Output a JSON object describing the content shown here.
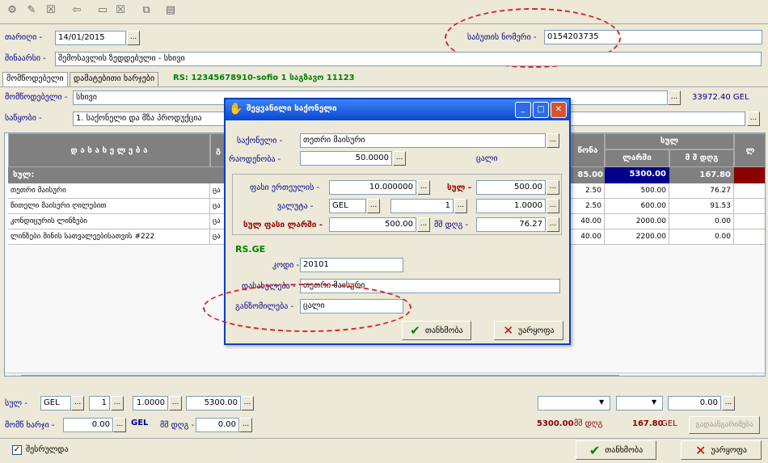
{
  "toolbar": {
    "icons": [
      "add-icon",
      "edit-icon",
      "delete-icon",
      "back-icon",
      "new-doc-icon",
      "cancel-doc-icon",
      "copy-icon",
      "print-icon"
    ]
  },
  "header": {
    "date_label": "თარიღი -",
    "date_value": "14/01/2015",
    "doc_number_label": "საბუთის ნომერი -",
    "doc_number_value": "0154203735",
    "note_label": "შინაარსი -",
    "note_value": "შემოსავლის ზედდებული - სხივი"
  },
  "tabs": {
    "supplier": "მომწოდებელი",
    "extra": "დამატებითი ხარჯები",
    "rs_info": "RS: 12345678910-sofio  1 საგზავო 11123"
  },
  "supplier": {
    "label": "მომწოდებელი -",
    "value": "სხივი",
    "amount": "33972.40 GEL"
  },
  "warehouse": {
    "label": "საწყობი -",
    "value": "1. საქონელი და მზა პროდუქცია"
  },
  "grid": {
    "col_name": "დ ა ს ა ხ ე ლ ე ბ ა",
    "col_g": "გ",
    "col_weight": "წონა",
    "col_sum": "სულ",
    "col_lari": "ლარში",
    "col_vat": "მ შ დღგ",
    "col_extra": "ლ",
    "total_label": "სულ:",
    "total_weight": "85.00",
    "total_lari": "5300.00",
    "total_vat": "167.80",
    "rows": [
      {
        "name": "თეთრი მაისური",
        "g": "ცა",
        "weight": "2.50",
        "lari": "500.00",
        "vat": "76.27"
      },
      {
        "name": "წითელი მაისური ღილებით",
        "g": "ცა",
        "weight": "2.50",
        "lari": "600.00",
        "vat": "91.53"
      },
      {
        "name": "კონდიცურის ლინზები",
        "g": "ცა",
        "weight": "40.00",
        "lari": "2000.00",
        "vat": "0.00"
      },
      {
        "name": "ლინზები მინის სათვალეებისათვის #222",
        "g": "ცა",
        "weight": "40.00",
        "lari": "2200.00",
        "vat": "0.00"
      }
    ]
  },
  "footer": {
    "sum_label": "სულ -",
    "currency": "GEL",
    "qty": "1",
    "rate": "1.0000",
    "amount": "5300.00",
    "extra_label": "მომწ ხარჯი -",
    "extra_value": "0.00",
    "extra_currency": "GEL",
    "vat_label": "მშ დღგ -",
    "vat_value": "0.00",
    "right_value": "0.00",
    "total_sum": "5300.00",
    "total_vat_label": "მშ დღგ",
    "total_vat": "167.80",
    "total_currency": "GEL",
    "recalc_label": "გადაანგარიშება",
    "posted_label": "შესრულდა",
    "ok_label": "თანხმობა",
    "cancel_label": "უარყოფა"
  },
  "dialog": {
    "title": "შეყვანილი საქონელი",
    "product_label": "საქონელი -",
    "product_value": "თეთრი მაისური",
    "qty_label": "რაოდენობა -",
    "qty_value": "50.0000",
    "unit": "ცალი",
    "unit_price_label": "ფასი ერთეულის -",
    "unit_price_value": "10.000000",
    "sum_label": "სულ -",
    "sum_value": "500.00",
    "currency_label": "ვალუტა -",
    "currency_value": "GEL",
    "currency_qty": "1",
    "currency_rate": "1.0000",
    "total_lari_label": "სულ ფასი ლარში -",
    "total_lari_value": "500.00",
    "vat_label": "მშ დღგ -",
    "vat_value": "76.27",
    "rs_header": "RS.GE",
    "code_label": "კოდი -",
    "code_value": "20101",
    "name_label": "დასახელება -",
    "name_value": "თეთრი მაისური",
    "unit_label": "განზომილება -",
    "unit_value": "ცალი",
    "ok_label": "თანხმობა",
    "cancel_label": "უარყოფა"
  }
}
